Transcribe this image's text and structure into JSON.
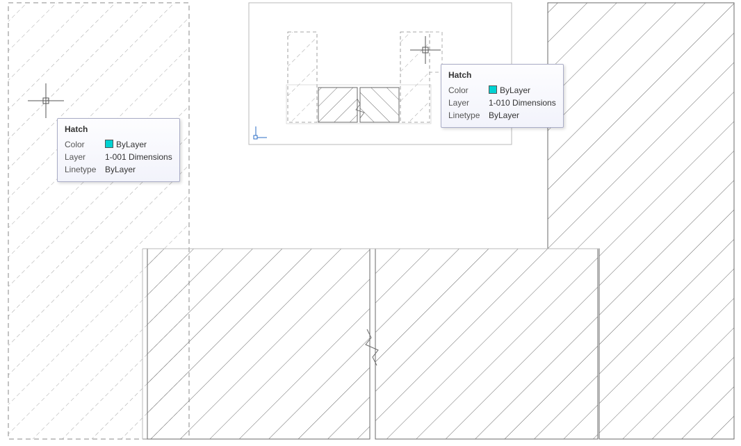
{
  "tooltip_left": {
    "title": "Hatch",
    "rows": {
      "color_label": "Color",
      "color_value": "ByLayer",
      "layer_label": "Layer",
      "layer_value": "1-001 Dimensions",
      "linetype_label": "Linetype",
      "linetype_value": "ByLayer"
    },
    "swatch_color": "#00d2d2"
  },
  "tooltip_right": {
    "title": "Hatch",
    "rows": {
      "color_label": "Color",
      "color_value": "ByLayer",
      "layer_label": "Layer",
      "layer_value": "1-010 Dimensions",
      "linetype_label": "Linetype",
      "linetype_value": "ByLayer"
    },
    "swatch_color": "#00d2d2"
  },
  "colors": {
    "outline": "#6a6a6a",
    "dash": "#9a9a9a",
    "light_outline": "#b8b8b8",
    "ucs": "#2b6cc4"
  }
}
